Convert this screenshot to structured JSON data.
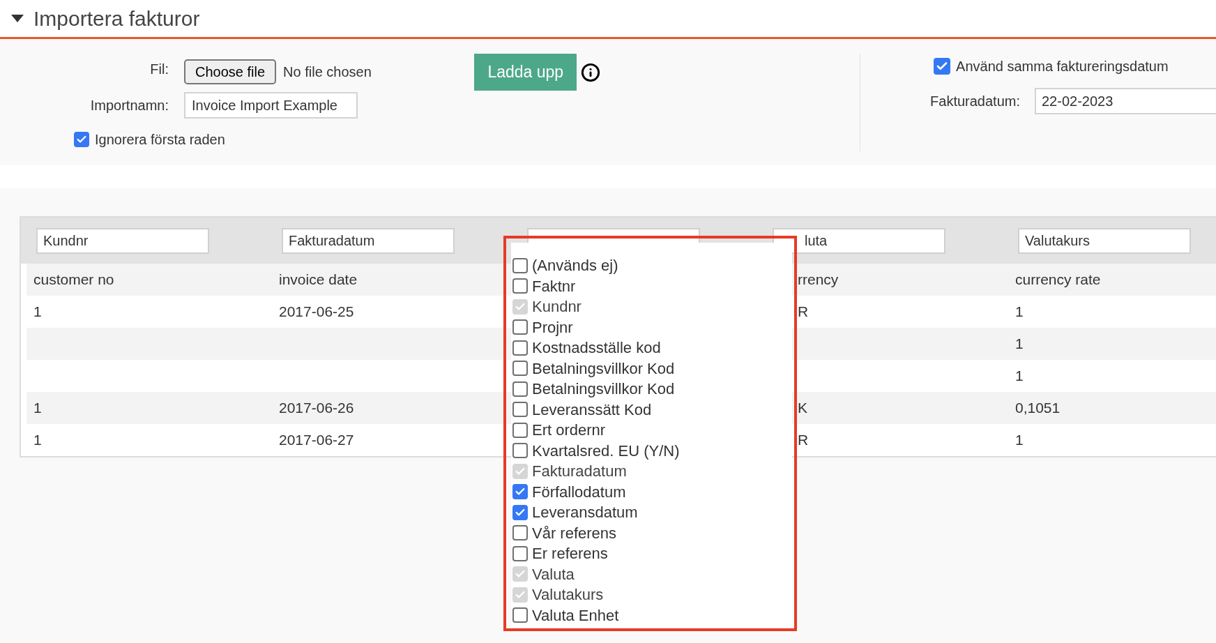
{
  "section": {
    "title": "Importera fakturor",
    "expanded": true
  },
  "form": {
    "file_label": "Fil:",
    "file_button": "Choose file",
    "file_status": "No file chosen",
    "name_label": "Importnamn:",
    "name_value": "Invoice Import Example",
    "ignore_first_row": {
      "label": "Ignorera första raden",
      "checked": true
    },
    "upload_button": "Ladda upp",
    "same_date": {
      "label": "Använd samma faktureringsdatum",
      "checked": true
    },
    "date_label": "Fakturadatum:",
    "date_value": "22-02-2023"
  },
  "table": {
    "columns": [
      {
        "field": "Kundnr",
        "heading": "customer no"
      },
      {
        "field": "Fakturadatum",
        "heading": "invoice date"
      },
      {
        "kind": "covered"
      },
      {
        "field": "luta",
        "heading": "rrency"
      },
      {
        "field": "Valutakurs",
        "heading": "currency rate"
      }
    ],
    "rows": [
      [
        "1",
        "2017-06-25",
        null,
        "R",
        "1"
      ],
      [
        null,
        null,
        null,
        null,
        "1"
      ],
      [
        null,
        null,
        null,
        null,
        "1"
      ],
      [
        "1",
        "2017-06-26",
        null,
        "K",
        "0,1051"
      ],
      [
        "1",
        "2017-06-27",
        null,
        "R",
        "1"
      ]
    ]
  },
  "dropdown": {
    "items": [
      {
        "label": "(Används ej)",
        "checked": false,
        "disabled": false
      },
      {
        "label": "Faktnr",
        "checked": false,
        "disabled": false
      },
      {
        "label": "Kundnr",
        "checked": true,
        "disabled": true
      },
      {
        "label": "Projnr",
        "checked": false,
        "disabled": false
      },
      {
        "label": "Kostnadsställe kod",
        "checked": false,
        "disabled": false
      },
      {
        "label": "Betalningsvillkor Kod",
        "checked": false,
        "disabled": false
      },
      {
        "label": "Betalningsvillkor Kod",
        "checked": false,
        "disabled": false
      },
      {
        "label": "Leveranssätt Kod",
        "checked": false,
        "disabled": false
      },
      {
        "label": "Ert ordernr",
        "checked": false,
        "disabled": false
      },
      {
        "label": "Kvartalsred. EU (Y/N)",
        "checked": false,
        "disabled": false
      },
      {
        "label": "Fakturadatum",
        "checked": true,
        "disabled": true
      },
      {
        "label": "Förfallodatum",
        "checked": true,
        "disabled": false
      },
      {
        "label": "Leveransdatum",
        "checked": true,
        "disabled": false
      },
      {
        "label": "Vår referens",
        "checked": false,
        "disabled": false
      },
      {
        "label": "Er referens",
        "checked": false,
        "disabled": false
      },
      {
        "label": "Valuta",
        "checked": true,
        "disabled": true
      },
      {
        "label": "Valutakurs",
        "checked": true,
        "disabled": true
      },
      {
        "label": "Valuta Enhet",
        "checked": false,
        "disabled": false
      }
    ]
  }
}
